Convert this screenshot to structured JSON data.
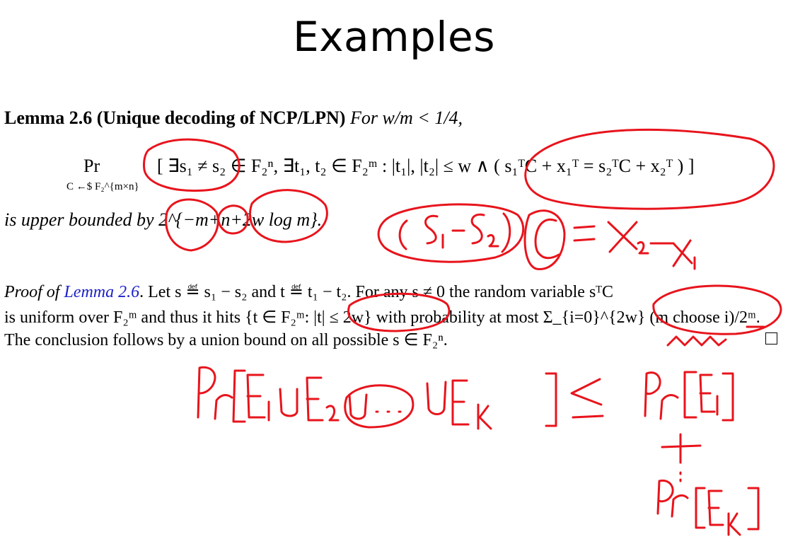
{
  "title": "Examples",
  "lemma": {
    "label": "Lemma 2.6 (Unique decoding of NCP/LPN)",
    "condition": "For w/m < 1/4,"
  },
  "equation": {
    "pr": "Pr",
    "subscript": "C ←$ F₂^{m×n}",
    "body": "[ ∃s₁ ≠ s₂ ∈ F₂ⁿ, ∃t₁, t₂ ∈ F₂ᵐ : |t₁|, |t₂| ≤ w ∧ ( s₁ᵀC + x₁ᵀ = s₂ᵀC + x₂ᵀ ) ]"
  },
  "bound": "is upper bounded by 2^{−m+n+2w log m}.",
  "proof": {
    "label": "Proof of",
    "ref": "Lemma 2.6",
    "line1": ". Let s ≝ s₁ − s₂ and t ≝ t₁ − t₂. For any s ≠ 0 the random variable sᵀC",
    "line2": "is uniform over F₂ᵐ and thus it hits {t ∈ F₂ᵐ: |t| ≤ 2w} with probability at most Σ_{i=0}^{2w} (m choose i)/2ᵐ.",
    "line3": "The conclusion follows by a union bound on all possible s ∈ F₂ⁿ."
  },
  "colors": {
    "ink": "#e8141c",
    "link": "#1e22c8"
  },
  "handwriting": [
    "(S₁ − S₂) C = x₂ − x₁",
    "Pr[E₁ ∪ E₂ ∪ … ∪ Eₖ] ≤ Pr[E₁] + … + Pr[Eₖ]"
  ]
}
